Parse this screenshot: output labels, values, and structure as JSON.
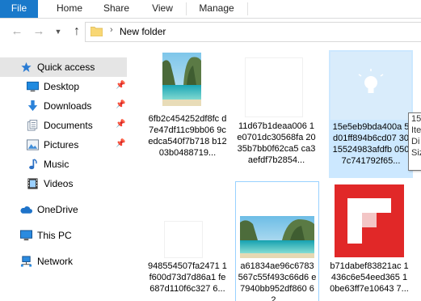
{
  "ribbon": {
    "file": "File",
    "home": "Home",
    "share": "Share",
    "view": "View",
    "manage": "Manage"
  },
  "address": {
    "path": "New folder"
  },
  "sidebar": {
    "quick_access": "Quick access",
    "items": [
      {
        "label": "Desktop",
        "icon": "desktop-icon",
        "pinned": true
      },
      {
        "label": "Downloads",
        "icon": "downloads-icon",
        "pinned": true
      },
      {
        "label": "Documents",
        "icon": "documents-icon",
        "pinned": true
      },
      {
        "label": "Pictures",
        "icon": "pictures-icon",
        "pinned": true
      },
      {
        "label": "Music",
        "icon": "music-icon",
        "pinned": false
      },
      {
        "label": "Videos",
        "icon": "videos-icon",
        "pinned": false
      }
    ],
    "onedrive": "OneDrive",
    "this_pc": "This PC",
    "network": "Network"
  },
  "files": [
    {
      "name": "6fb2c454252df8fc d7e47df11c9bb06 9cedca540f7b718 b1203b0488719...",
      "thumb": "lagoon-portrait"
    },
    {
      "name": "11d67b1deaa006 1e0701dc30568fa 2035b7bb0f62ca5 ca3aefdf7b2854...",
      "thumb": "blank"
    },
    {
      "name": "15e5eb9bda400a 5d01ff894b6cd07 3015524983afdfb 0507c741792f65...",
      "thumb": "bulb-placeholder",
      "selected": true
    },
    {
      "name": "948554507fa2471 1f600d73d7d86a1 fe687d110f6c327 6...",
      "thumb": "blank-small"
    },
    {
      "name": "a61834ae96c6783 567c55f493c66d6 e7940bb952df860 62...",
      "thumb": "lagoon-landscape",
      "outlined": true
    },
    {
      "name": "b71dabef83821ac 1436c6e54eed365 10be63ff7e10643 7...",
      "thumb": "flipboard-logo"
    }
  ],
  "tooltip": [
    "15",
    "Ite",
    "Di",
    "Siz"
  ],
  "colors": {
    "accent": "#1979ca",
    "selection": "#cce8ff",
    "flipboard_red": "#e12828"
  }
}
